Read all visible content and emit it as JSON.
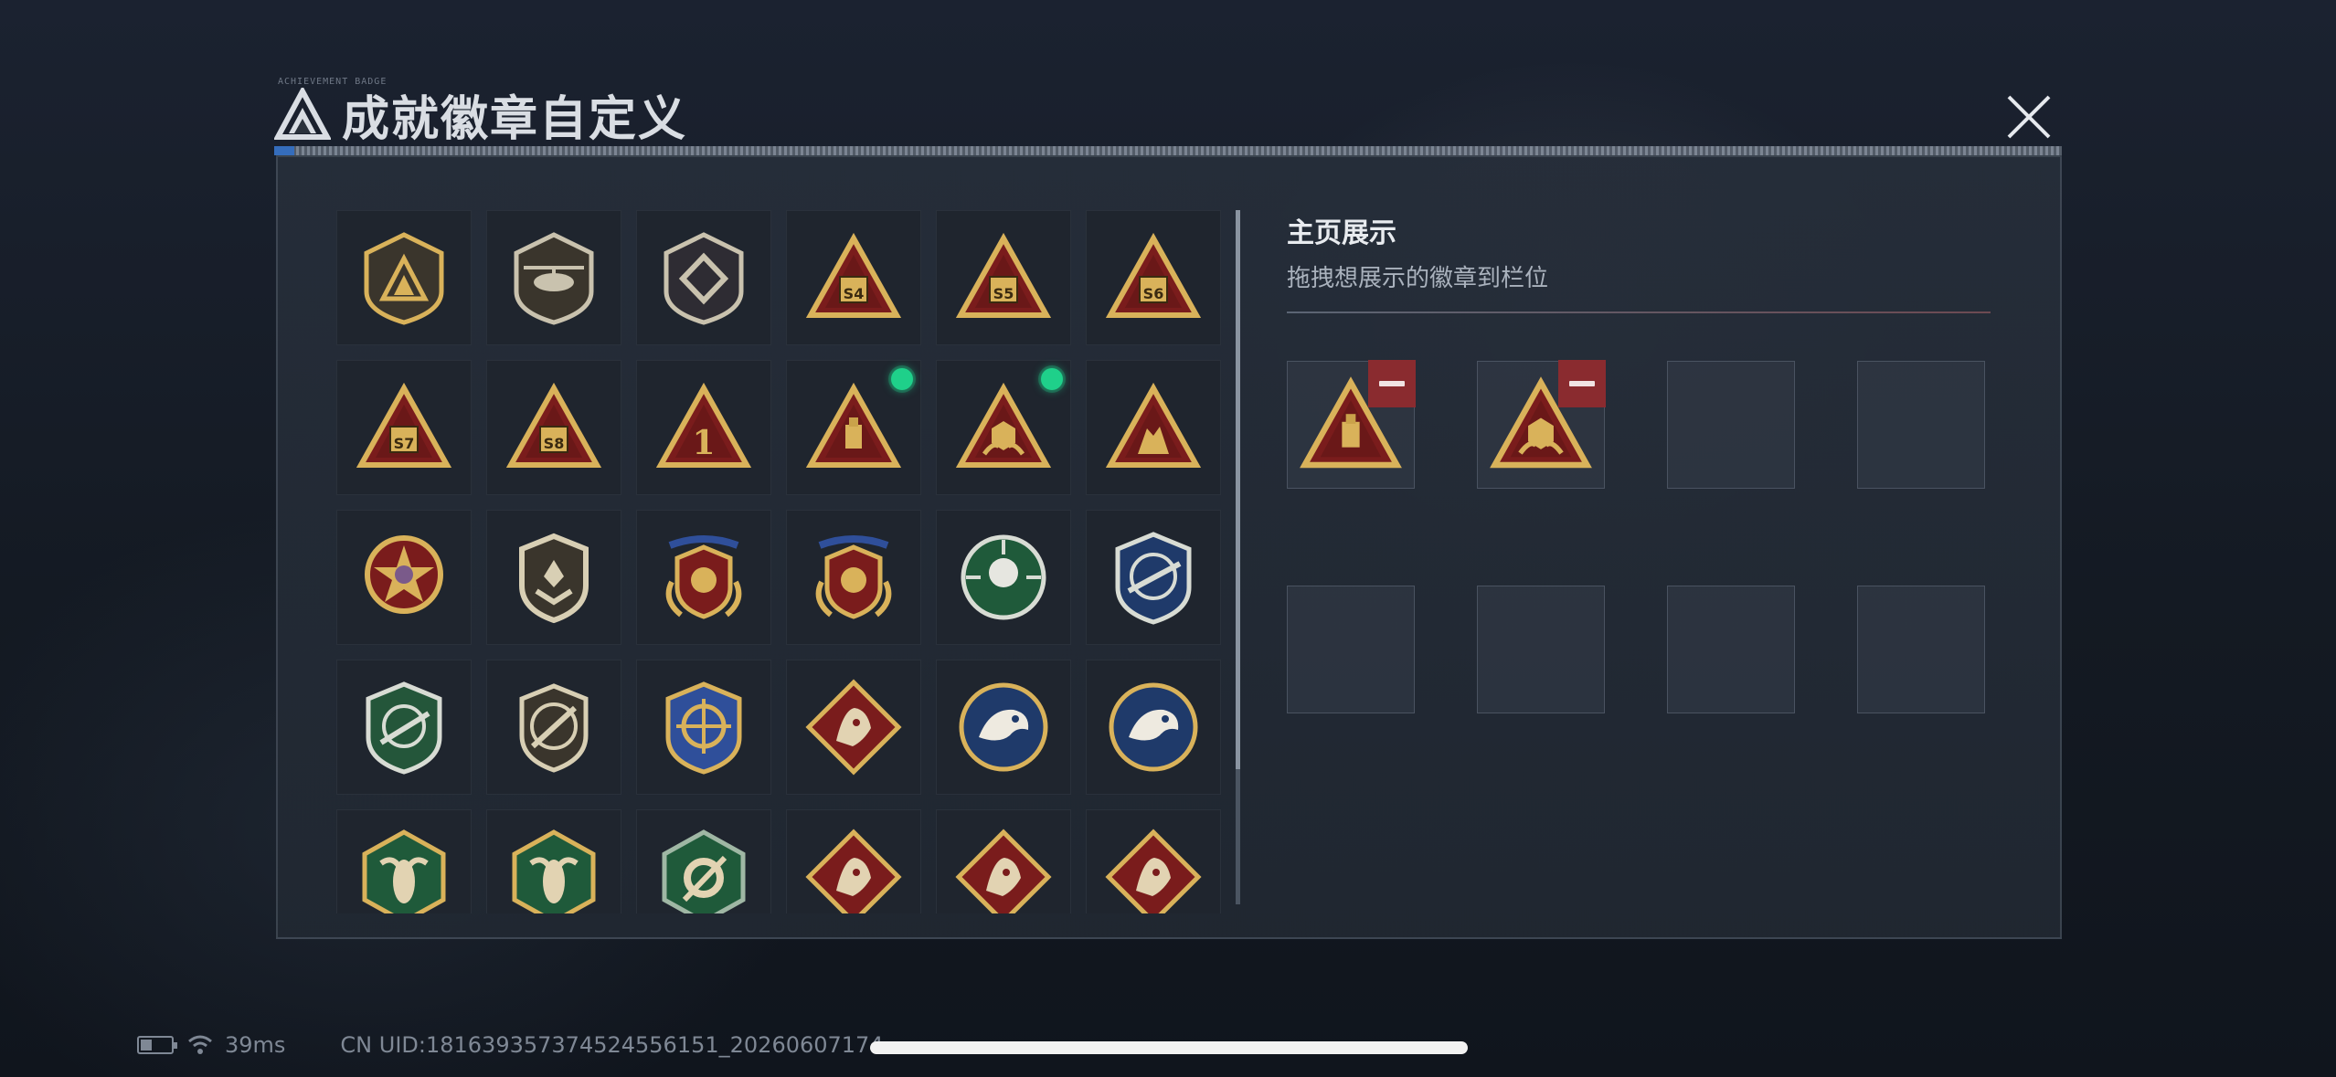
{
  "header": {
    "title": "成就徽章自定义",
    "tag": "ACHIEVEMENT BADGE"
  },
  "collection": {
    "badges": [
      {
        "icon": "shield-logo-badge",
        "new": false
      },
      {
        "icon": "helicopter-badge",
        "new": false
      },
      {
        "icon": "shield-diamond-badge",
        "new": false
      },
      {
        "icon": "season-s4-badge",
        "label": "S4",
        "new": false
      },
      {
        "icon": "season-s5-badge",
        "label": "S5",
        "new": false
      },
      {
        "icon": "season-s6-badge",
        "label": "S6",
        "new": false
      },
      {
        "icon": "season-s7-badge",
        "label": "S7",
        "new": false
      },
      {
        "icon": "season-s8-badge",
        "label": "S8",
        "new": false
      },
      {
        "icon": "rank-1-badge",
        "label": "1",
        "new": false
      },
      {
        "icon": "usb-triangle-badge",
        "new": true
      },
      {
        "icon": "dice-hands-badge",
        "new": true
      },
      {
        "icon": "soldiers-triangle-badge",
        "new": false
      },
      {
        "icon": "star-medal-badge",
        "new": false
      },
      {
        "icon": "shield-chevron-badge",
        "new": false
      },
      {
        "icon": "winged-shield-badge",
        "new": false
      },
      {
        "icon": "winged-shield-red-badge",
        "new": false
      },
      {
        "icon": "skull-crosshair-badge",
        "new": false
      },
      {
        "icon": "sniper-blue-badge",
        "new": false
      },
      {
        "icon": "rifle-green-badge",
        "new": false
      },
      {
        "icon": "rifle-circle-badge",
        "new": false
      },
      {
        "icon": "crosshair-shield-badge",
        "new": false
      },
      {
        "icon": "wolf-diamond-badge",
        "new": false
      },
      {
        "icon": "eagle-blue-badge",
        "new": false
      },
      {
        "icon": "eagle-blue-2-badge",
        "new": false
      },
      {
        "icon": "wasp-green-badge",
        "new": false
      },
      {
        "icon": "wasp-green-2-badge",
        "new": false
      },
      {
        "icon": "gear-green-badge",
        "new": false
      },
      {
        "icon": "dragon-diamond-badge",
        "new": false
      },
      {
        "icon": "dragon-diamond-2-badge",
        "new": false
      },
      {
        "icon": "runner-diamond-badge",
        "new": false
      }
    ]
  },
  "showcase": {
    "title": "主页展示",
    "subtitle": "拖拽想展示的徽章到栏位",
    "slots": [
      {
        "icon": "usb-triangle-badge",
        "filled": true
      },
      {
        "icon": "dice-hands-badge",
        "filled": true
      },
      {
        "filled": false
      },
      {
        "filled": false
      },
      {
        "filled": false
      },
      {
        "filled": false
      },
      {
        "filled": false
      },
      {
        "filled": false
      }
    ]
  },
  "status": {
    "ping": "39ms",
    "uid": "CN UID:18163935737452455615​1_20260607174"
  },
  "colors": {
    "accent_new": "#1fd08a",
    "remove": "#8a2b2f",
    "gold": "#d9b25a",
    "badge_red": "#7a1c1c"
  }
}
